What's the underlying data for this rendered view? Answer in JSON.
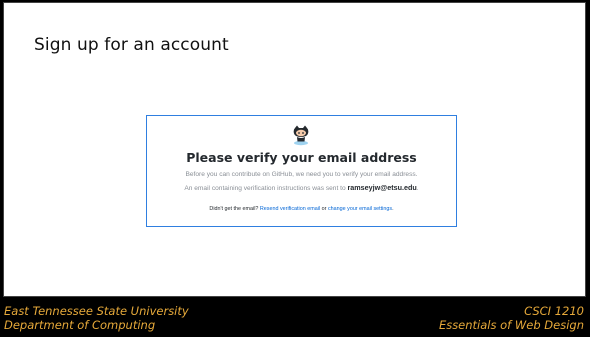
{
  "slide": {
    "title": "Sign up for an account"
  },
  "github_card": {
    "heading": "Please verify your email address",
    "line1": "Before you can contribute on GitHub, we need you to verify your email address.",
    "line2_prefix": "An email containing verification instructions was sent to ",
    "email": "ramseyjw@etsu.edu",
    "line2_suffix": ".",
    "resend_prefix": "Didn't get the email? ",
    "resend_link": "Resend verification email",
    "resend_mid": " or ",
    "change_link": "change your email settings",
    "resend_suffix": "."
  },
  "footer": {
    "left_line1": "East Tennessee State University",
    "left_line2": "Department of Computing",
    "right_line1": "CSCI 1210",
    "right_line2": "Essentials of Web Design"
  },
  "colors": {
    "footer_text": "#e6a93a",
    "card_border": "#2f7fe0",
    "link": "#0366d6"
  },
  "icons": {
    "octocat": "octocat-icon"
  }
}
